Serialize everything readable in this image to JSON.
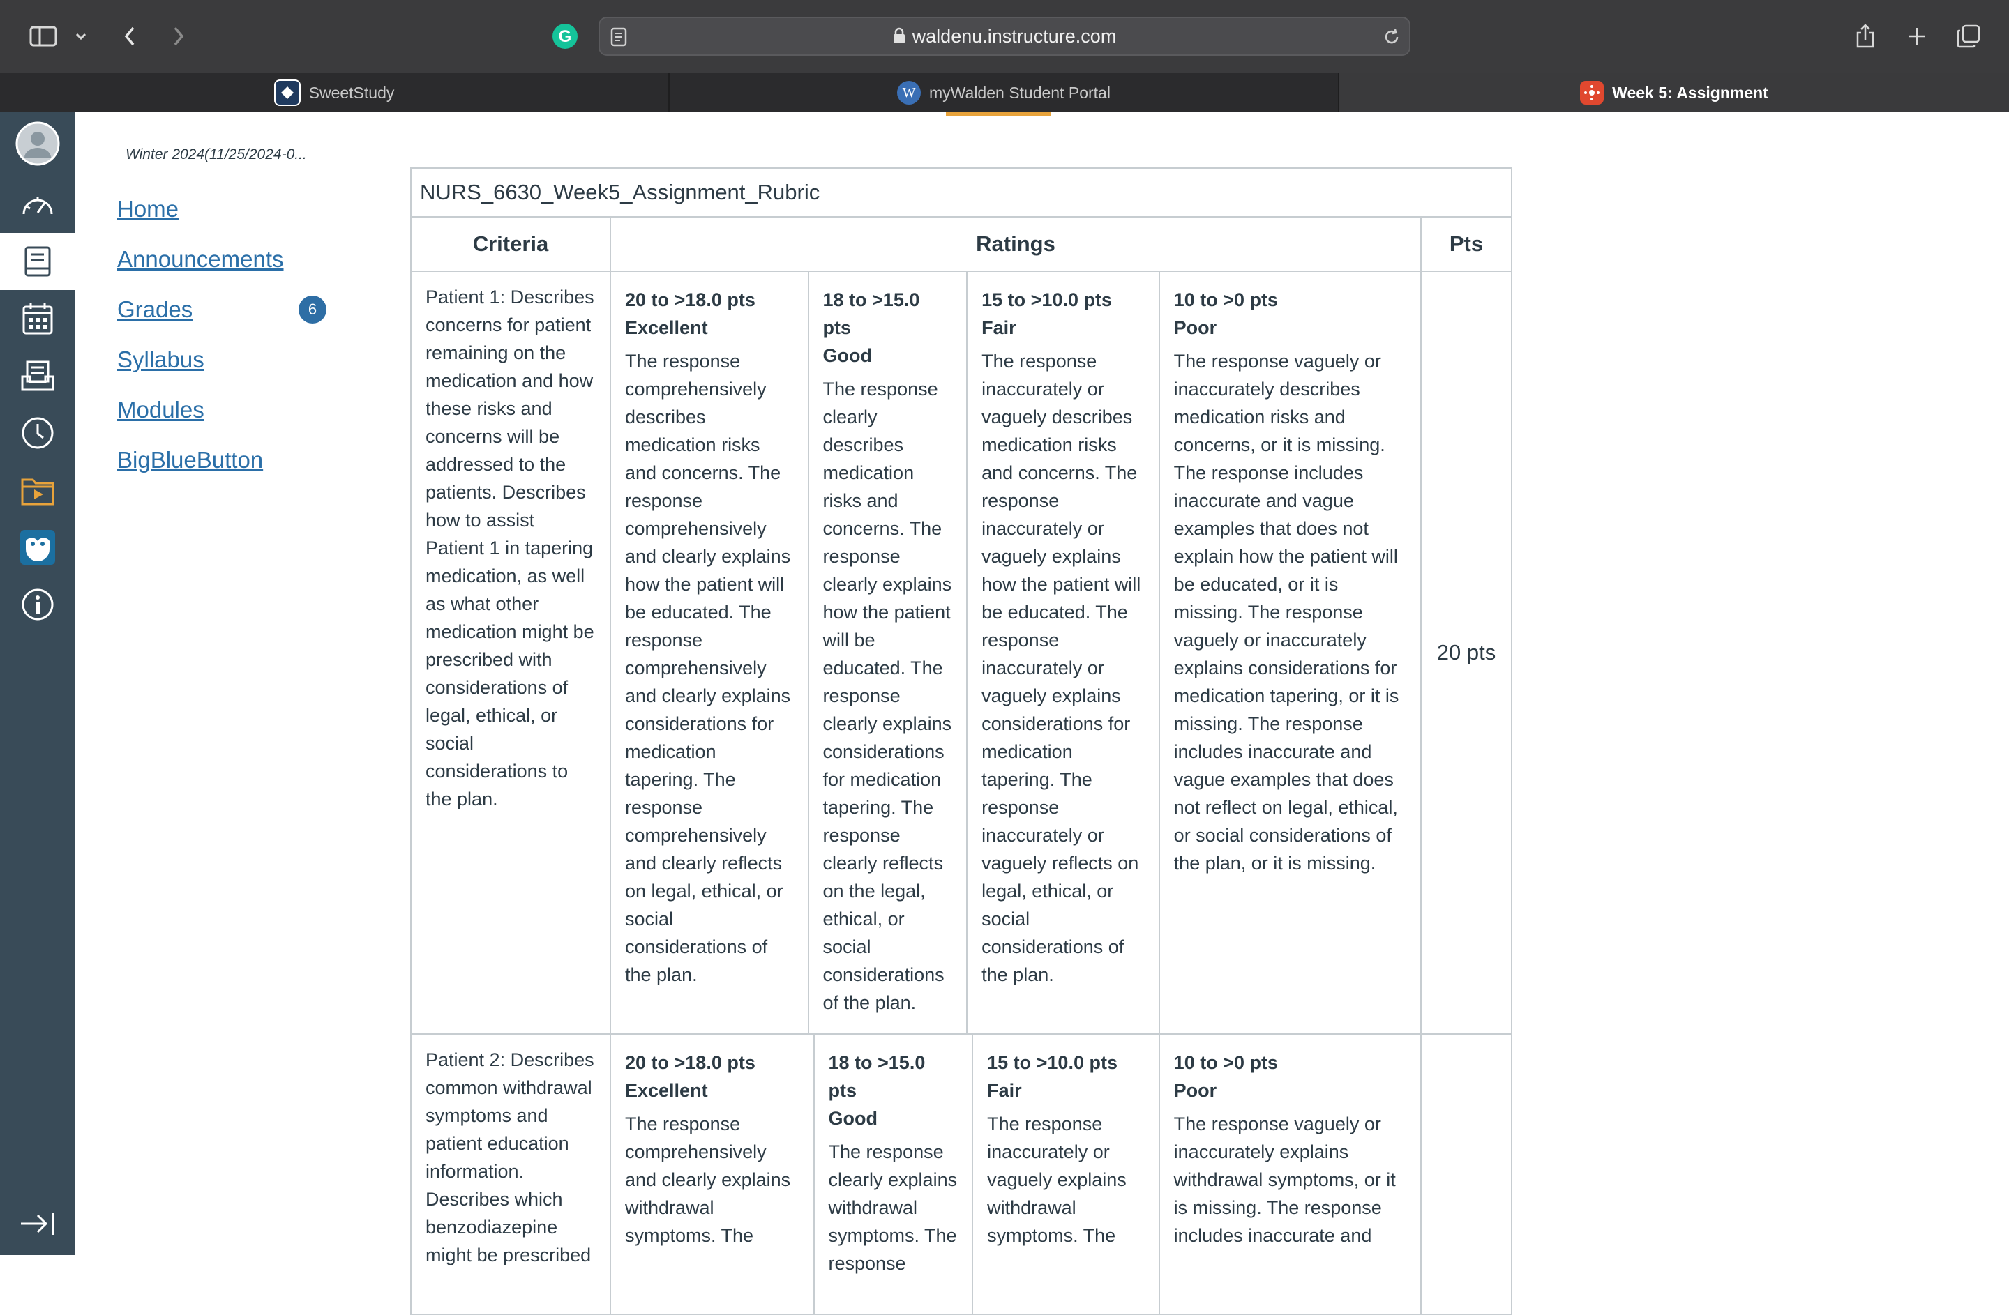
{
  "browser": {
    "url": "waldenu.instructure.com",
    "tabs": [
      {
        "label": "SweetStudy",
        "active": false
      },
      {
        "label": "myWalden Student Portal",
        "active": false
      },
      {
        "label": "Week 5: Assignment",
        "active": true
      }
    ]
  },
  "course": {
    "term": "Winter 2024(11/25/2024-0...",
    "nav": [
      {
        "label": "Home"
      },
      {
        "label": "Announcements"
      },
      {
        "label": "Grades",
        "badge": "6"
      },
      {
        "label": "Syllabus"
      },
      {
        "label": "Modules"
      },
      {
        "label": "BigBlueButton"
      }
    ]
  },
  "global_nav": {
    "icons": [
      "account-icon",
      "dashboard-icon",
      "courses-icon",
      "calendar-icon",
      "inbox-icon",
      "history-icon",
      "commons-icon",
      "owl-icon",
      "help-icon",
      "collapse-icon"
    ],
    "colors": {
      "bg": "#394b58",
      "accent_commons": "#e8a33b"
    }
  },
  "rubric": {
    "title": "NURS_6630_Week5_Assignment_Rubric",
    "headers": {
      "criteria": "Criteria",
      "ratings": "Ratings",
      "pts": "Pts"
    },
    "rows": [
      {
        "criteria": "Patient 1: Describes concerns for patient remaining on the medication and how these risks and concerns will be addressed to the patients. Describes how to assist Patient 1 in tapering medication, as well as what other medication might be prescribed with considerations of legal, ethical, or social considerations to the plan.",
        "points": "20 pts",
        "ratings": [
          {
            "pts": "20 to >18.0 pts",
            "name": "Excellent",
            "desc": "The response comprehensively describes medication risks and concerns. The response comprehensively and clearly explains how the patient will be educated. The response comprehensively and clearly explains considerations for medication tapering. The response comprehensively and clearly reflects on legal, ethical, or social considerations of the plan."
          },
          {
            "pts": "18 to >15.0 pts",
            "name": "Good",
            "desc": "The response clearly describes medication risks and concerns. The response clearly explains how the patient will be educated. The response clearly explains considerations for medication tapering. The response clearly reflects on the legal, ethical, or social considerations of the plan."
          },
          {
            "pts": "15 to >10.0 pts",
            "name": "Fair",
            "desc": "The response inaccurately or vaguely describes medication risks and concerns. The response inaccurately or vaguely explains how the patient will be educated. The response inaccurately or vaguely explains considerations for medication tapering. The response inaccurately or vaguely reflects on legal, ethical, or social considerations of the plan."
          },
          {
            "pts": "10 to >0 pts",
            "name": "Poor",
            "desc": "The response vaguely or inaccurately describes medication risks and concerns, or it is missing. The response includes inaccurate and vague examples that does not explain how the patient will be educated, or it is missing. The response vaguely or inaccurately explains considerations for medication tapering, or it is missing. The response includes inaccurate and vague examples that does not reflect on legal, ethical, or social considerations of the plan, or it is missing."
          }
        ]
      },
      {
        "criteria": "Patient 2: Describes common withdrawal symptoms and patient education information. Describes which benzodiazepine might be prescribed",
        "points": "",
        "ratings": [
          {
            "pts": "20 to >18.0 pts",
            "name": "Excellent",
            "desc": "The response comprehensively and clearly explains withdrawal symptoms. The"
          },
          {
            "pts": "18 to >15.0 pts",
            "name": "Good",
            "desc": "The response clearly explains withdrawal symptoms. The response"
          },
          {
            "pts": "15 to >10.0 pts",
            "name": "Fair",
            "desc": "The response inaccurately or vaguely explains withdrawal symptoms. The"
          },
          {
            "pts": "10 to >0 pts",
            "name": "Poor",
            "desc": "The response vaguely or inaccurately explains withdrawal symptoms, or it is missing. The response includes inaccurate and"
          }
        ]
      }
    ]
  }
}
